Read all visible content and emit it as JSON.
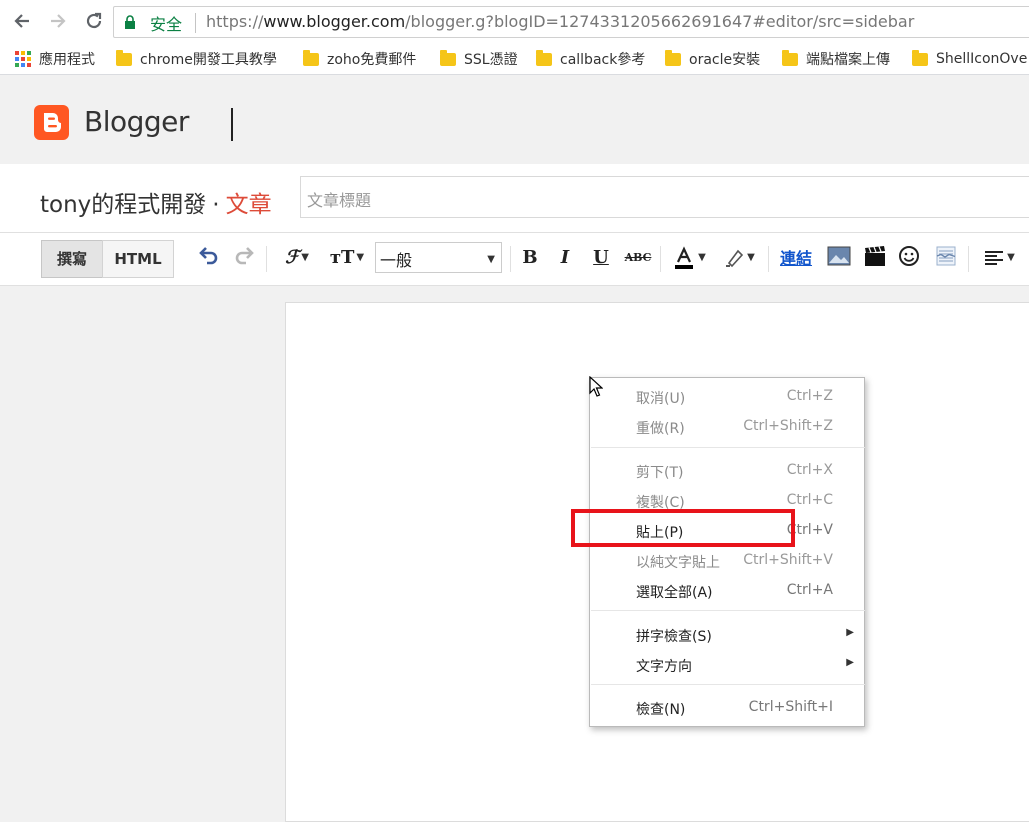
{
  "browser": {
    "secure_label": "安全",
    "url_scheme": "https://",
    "url_host": "www.blogger.com",
    "url_path": "/blogger.g?blogID=1274331205662691647#editor/src=sidebar",
    "bookmarks": [
      {
        "label": "應用程式",
        "type": "apps"
      },
      {
        "label": "chrome開發工具教學",
        "type": "folder"
      },
      {
        "label": "zoho免費郵件",
        "type": "folder"
      },
      {
        "label": "SSL憑證",
        "type": "folder"
      },
      {
        "label": "callback參考",
        "type": "folder"
      },
      {
        "label": "oracle安裝",
        "type": "folder"
      },
      {
        "label": "端點檔案上傳",
        "type": "folder"
      },
      {
        "label": "ShellIconOve",
        "type": "folder"
      }
    ]
  },
  "blogger": {
    "logo_text": "Blogger",
    "blog_name": "tony的程式開發",
    "crumb_sep": "·",
    "section": "文章",
    "title_placeholder": "文章標題"
  },
  "toolbar": {
    "compose_label": "撰寫",
    "html_label": "HTML",
    "style_select": "一般",
    "link_label": "連結"
  },
  "context_menu": {
    "groups": [
      [
        {
          "label": "取消(U)",
          "shortcut": "Ctrl+Z",
          "enabled": false
        },
        {
          "label": "重做(R)",
          "shortcut": "Ctrl+Shift+Z",
          "enabled": false
        }
      ],
      [
        {
          "label": "剪下(T)",
          "shortcut": "Ctrl+X",
          "enabled": false
        },
        {
          "label": "複製(C)",
          "shortcut": "Ctrl+C",
          "enabled": false
        },
        {
          "label": "貼上(P)",
          "shortcut": "Ctrl+V",
          "enabled": true,
          "highlighted": true
        },
        {
          "label": "以純文字貼上",
          "shortcut": "Ctrl+Shift+V",
          "enabled": false
        },
        {
          "label": "選取全部(A)",
          "shortcut": "Ctrl+A",
          "enabled": true
        }
      ],
      [
        {
          "label": "拼字檢查(S)",
          "submenu": true,
          "enabled": true
        },
        {
          "label": "文字方向",
          "submenu": true,
          "enabled": true
        }
      ],
      [
        {
          "label": "檢查(N)",
          "shortcut": "Ctrl+Shift+I",
          "enabled": true
        }
      ]
    ]
  },
  "colors": {
    "accent": "#ff5722",
    "secure_green": "#0b8043",
    "highlight_red": "#e8131a",
    "link_blue": "#1155cc"
  }
}
